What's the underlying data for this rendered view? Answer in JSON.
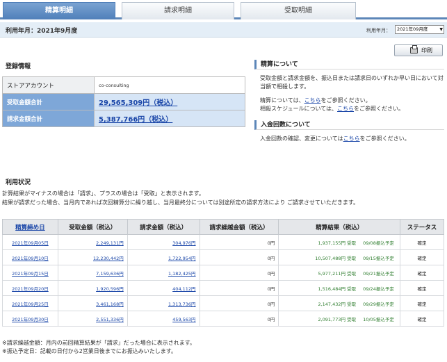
{
  "tabs": [
    {
      "label": "精算明細",
      "active": true
    },
    {
      "label": "請求明細",
      "active": false
    },
    {
      "label": "受取明細",
      "active": false
    }
  ],
  "period": {
    "text": "利用年月：2021年9月度",
    "select_label": "利用年月：",
    "select_value": "2021年09月度"
  },
  "print_label": "印刷",
  "registration": {
    "title": "登録情報",
    "rows": [
      {
        "label": "ストアアカウント",
        "value": "co-consulting"
      },
      {
        "label": "受取金額合計",
        "value": "29,565,309円（税込）"
      },
      {
        "label": "請求金額合計",
        "value": "5,387,766円（税込）"
      }
    ]
  },
  "settlement": {
    "title": "精算について",
    "text1": "受取金額と請求金額を、振込日または請求日のいずれか早い日において対当額で相殺します。",
    "line2_pre": "精算については、",
    "link": "こちら",
    "line2_post": "をご参照ください。",
    "line3_pre": "相殺スケジュールについては、",
    "line3_post": "をご参照ください。"
  },
  "deposit": {
    "title": "入金回数について",
    "pre": "入金回数の確認、変更については",
    "link": "こちら",
    "post": "をご参照ください。"
  },
  "usage": {
    "title": "利用状況",
    "note1": "計算結果がマイナスの場合は「請求」、プラスの場合は「受取」と表示されます。",
    "note2": "結果が請求だった場合、当月内であれば次回精算分に繰り越し、当月最終分については別途所定の請求方法により ご請求させていただきます。"
  },
  "table": {
    "headers": [
      "精算締め日",
      "受取金額（税込）",
      "請求金額（税込）",
      "請求繰越金額（税込）",
      "精算結果（税込）",
      "ステータス"
    ],
    "rows": [
      {
        "date": "2021年09月05日",
        "recv": "2,249,131円",
        "bill": "304,976円",
        "carry": "0円",
        "result": "1,937,155円 受取",
        "sched": "09/08振込予定",
        "status": "確定"
      },
      {
        "date": "2021年09月10日",
        "recv": "12,230,442円",
        "bill": "1,722,954円",
        "carry": "0円",
        "result": "10,507,488円 受取",
        "sched": "09/15振込予定",
        "status": "確定"
      },
      {
        "date": "2021年09月15日",
        "recv": "7,159,636円",
        "bill": "1,182,425円",
        "carry": "0円",
        "result": "5,977,211円 受取",
        "sched": "09/21振込予定",
        "status": "確定"
      },
      {
        "date": "2021年09月20日",
        "recv": "1,920,596円",
        "bill": "404,112円",
        "carry": "0円",
        "result": "1,516,484円 受取",
        "sched": "09/24振込予定",
        "status": "確定"
      },
      {
        "date": "2021年09月25日",
        "recv": "3,461,168円",
        "bill": "1,313,736円",
        "carry": "0円",
        "result": "2,147,432円 受取",
        "sched": "09/29振込予定",
        "status": "確定"
      },
      {
        "date": "2021年09月30日",
        "recv": "2,551,336円",
        "bill": "459,563円",
        "carry": "0円",
        "result": "2,091,773円 受取",
        "sched": "10/05振込予定",
        "status": "確定"
      }
    ]
  },
  "footnotes": [
    "※請求繰越金額：月内の前回精算結果が「請求」だった場合に表示されます。",
    "※振込予定日：記載の日付から2営業日後までにお振込みいたします。"
  ],
  "colors": {
    "accent": "#5c86b8",
    "link": "#1a46a8",
    "result_green": "#2e7d2e"
  }
}
